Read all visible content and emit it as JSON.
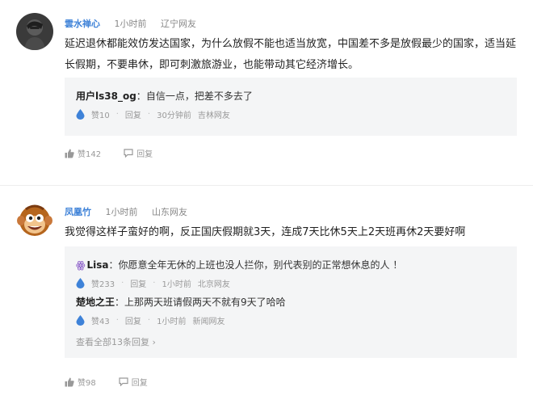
{
  "comments": [
    {
      "username": "雲水禅心",
      "time": "1小时前",
      "location": "辽宁网友",
      "text": "延迟退休都能效仿发达国家，为什么放假不能也适当放宽，中国差不多是放假最少的国家，适当延长假期，不要串休，即可刺激旅游业，也能带动其它经济增长。",
      "replies": [
        {
          "name": "用户ls38_og",
          "text": "自信一点，把差不多去了",
          "likes": "赞10",
          "reply_label": "回复",
          "time": "30分钟前",
          "location": "吉林网友"
        }
      ],
      "likes": "赞142",
      "reply_label": "回复"
    },
    {
      "username": "凤凰竹",
      "time": "1小时前",
      "location": "山东网友",
      "text": "我觉得这样子蛮好的啊，反正国庆假期就3天，连成7天比休5天上2天班再休2天要好啊",
      "replies": [
        {
          "name": "Lisa",
          "text": "你愿意全年无休的上班也没人拦你，别代表别的正常想休息的人 ！",
          "likes": "赞233",
          "reply_label": "回复",
          "time": "1小时前",
          "location": "北京网友"
        },
        {
          "name": "楚地之王",
          "text": "上那两天班请假两天不就有9天了哈哈",
          "likes": "赞43",
          "reply_label": "回复",
          "time": "1小时前",
          "location": "新闻网友"
        }
      ],
      "view_all": "查看全部13条回复",
      "likes": "赞98",
      "reply_label": "回复"
    }
  ],
  "icons": {
    "drop": "water-drop-icon",
    "like": "thumbs-up-icon",
    "reply": "speech-bubble-icon",
    "chevron": "chevron-right-icon"
  },
  "colors": {
    "username": "#3e82d8",
    "drop": "#3e82d8",
    "reply_bg": "#f4f5f6",
    "meta": "#888888"
  }
}
